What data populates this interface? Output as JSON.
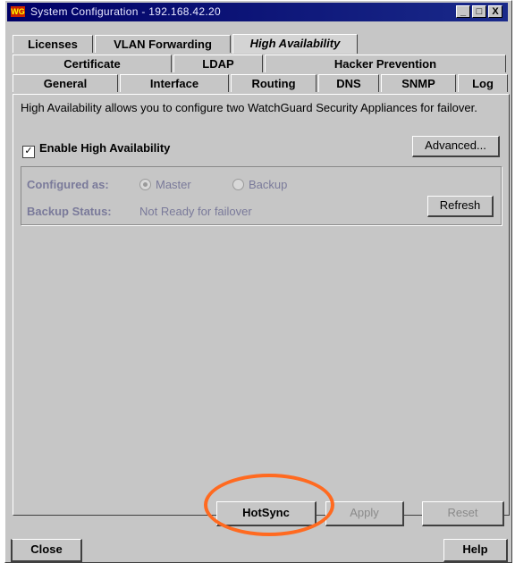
{
  "window": {
    "title": "System Configuration - 192.168.42.20",
    "icon_label": "WG",
    "controls": {
      "minimize": "_",
      "maximize": "□",
      "close": "X"
    }
  },
  "tabs": {
    "row1": [
      "Licenses",
      "VLAN Forwarding",
      "High Availability"
    ],
    "row2": [
      "Certificate",
      "LDAP",
      "Hacker Prevention"
    ],
    "row3": [
      "General",
      "Interface",
      "Routing",
      "DNS",
      "SNMP",
      "Log"
    ],
    "active": "High Availability"
  },
  "panel": {
    "description": "High Availability allows you to configure two WatchGuard Security Appliances for failover.",
    "enable_checkbox_label": "Enable High Availability",
    "enable_checked": true,
    "checkmark": "✓",
    "advanced_button": "Advanced...",
    "configured_as_label": "Configured as:",
    "radio_master": "Master",
    "radio_backup": "Backup",
    "backup_status_label": "Backup Status:",
    "backup_status_value": "Not Ready for failover",
    "refresh_button": "Refresh"
  },
  "actions": {
    "hotsync": "HotSync",
    "apply": "Apply",
    "reset": "Reset"
  },
  "footer": {
    "close": "Close",
    "help": "Help"
  },
  "colors": {
    "highlight_ring": "#ff6a20",
    "titlebar": "#000066"
  }
}
